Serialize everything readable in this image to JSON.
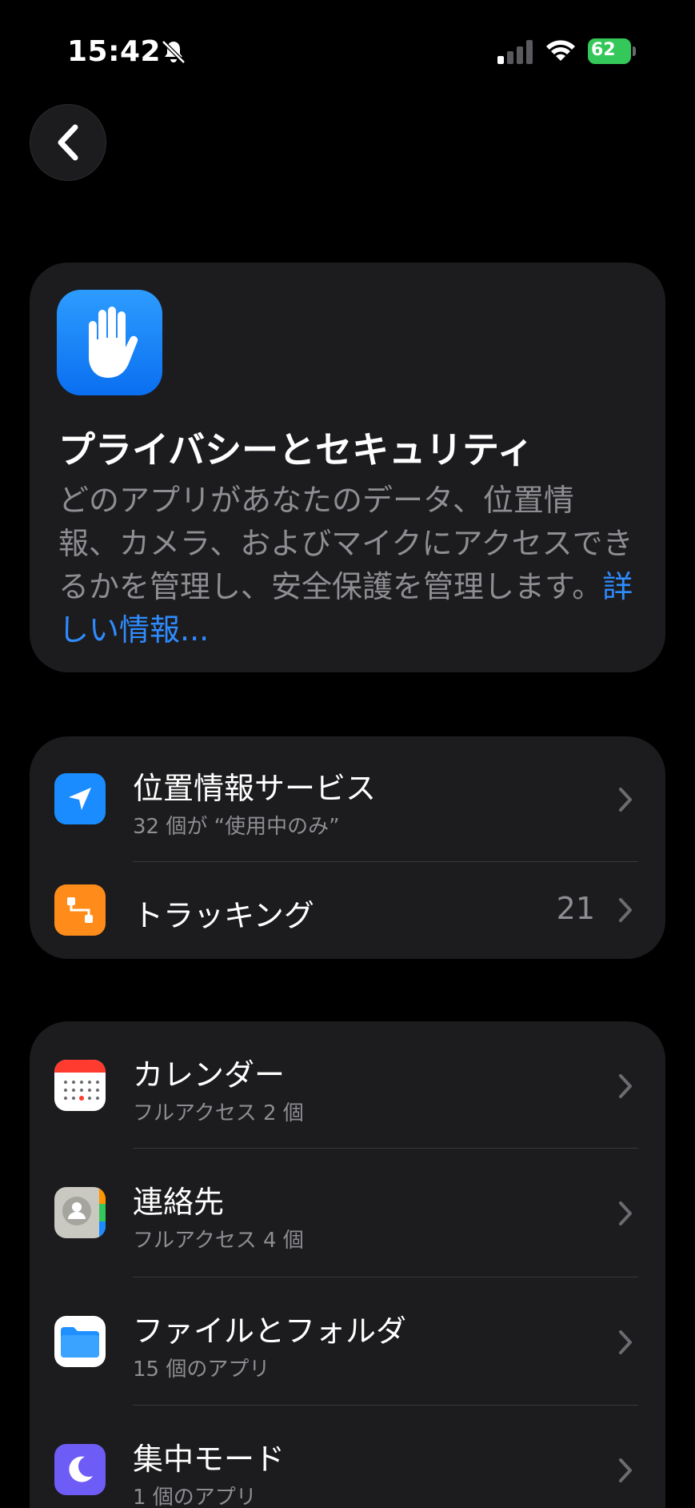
{
  "status_bar": {
    "time": "15:42",
    "battery": "62"
  },
  "hero": {
    "title": "プライバシーとセキュリティ",
    "description": "どのアプリがあなたのデータ、位置情報、カメラ、およびマイクにアクセスできるかを管理し、安全保護を管理します。",
    "link": "詳しい情報..."
  },
  "group1": {
    "location": {
      "title": "位置情報サービス",
      "subtitle": "32 個が “使用中のみ”",
      "icon": "location-arrow-icon"
    },
    "tracking": {
      "title": "トラッキング",
      "value": "21",
      "icon": "tracking-icon"
    }
  },
  "group2": {
    "calendar": {
      "title": "カレンダー",
      "subtitle": "フルアクセス 2 個",
      "icon": "calendar-icon"
    },
    "contacts": {
      "title": "連絡先",
      "subtitle": "フルアクセス 4 個",
      "icon": "contacts-icon"
    },
    "files": {
      "title": "ファイルとフォルダ",
      "subtitle": "15 個のアプリ",
      "icon": "folder-icon"
    },
    "focus": {
      "title": "集中モード",
      "subtitle": "1 個のアプリ",
      "icon": "moon-icon"
    }
  },
  "colors": {
    "background": "#000000",
    "card": "#1c1c1e",
    "accent_link": "#2f8cff",
    "secondary_text": "#8d8d92",
    "battery_green": "#34c759"
  }
}
